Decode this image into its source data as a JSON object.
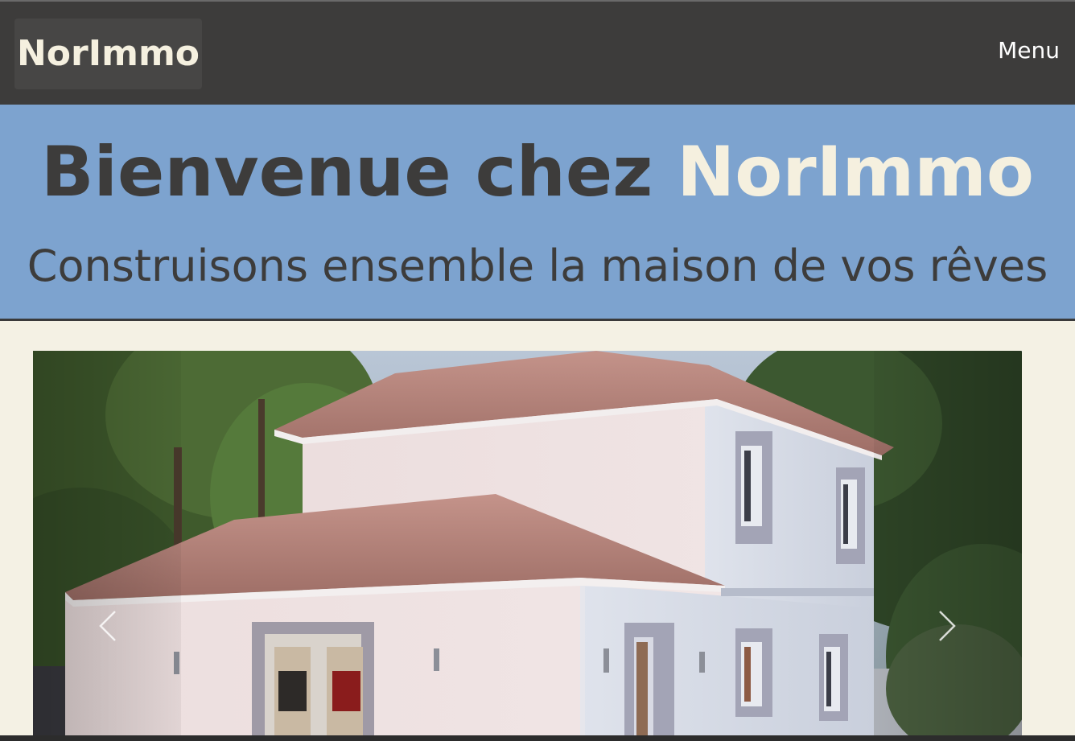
{
  "navbar": {
    "brand": "NorImmo",
    "menu_label": "Menu"
  },
  "hero": {
    "title_prefix": "Bienvenue chez",
    "title_brand": "NorImmo",
    "subtitle": "Construisons ensemble la maison de vos rêves"
  },
  "carousel": {
    "prev_icon": "chevron-left-icon",
    "next_icon": "chevron-right-icon"
  },
  "colors": {
    "navbar_bg": "#3d3c3b",
    "hero_bg": "#7da3cf",
    "page_bg": "#f4f1e4",
    "brand_text": "#f5f0df"
  }
}
